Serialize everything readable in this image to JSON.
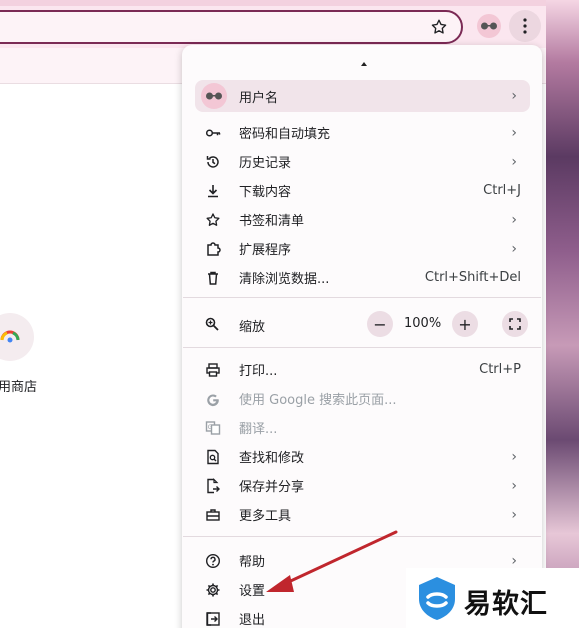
{
  "menu": {
    "profile": {
      "label": "用户名"
    },
    "items1": [
      {
        "label": "密码和自动填充",
        "shortcut": "",
        "submenu": true,
        "icon": "key-icon"
      },
      {
        "label": "历史记录",
        "shortcut": "",
        "submenu": true,
        "icon": "history-icon"
      },
      {
        "label": "下载内容",
        "shortcut": "Ctrl+J",
        "submenu": false,
        "icon": "download-icon"
      },
      {
        "label": "书签和清单",
        "shortcut": "",
        "submenu": true,
        "icon": "star-icon"
      },
      {
        "label": "扩展程序",
        "shortcut": "",
        "submenu": true,
        "icon": "puzzle-icon"
      },
      {
        "label": "清除浏览数据...",
        "shortcut": "Ctrl+Shift+Del",
        "submenu": false,
        "icon": "trash-icon"
      }
    ],
    "zoom": {
      "label": "缩放",
      "value": "100%",
      "minus": "−",
      "plus": "+"
    },
    "items2": [
      {
        "label": "打印...",
        "shortcut": "Ctrl+P",
        "submenu": false,
        "icon": "print-icon",
        "disabled": false
      },
      {
        "label": "使用 Google 搜索此页面...",
        "shortcut": "",
        "submenu": false,
        "icon": "google-icon",
        "disabled": true
      },
      {
        "label": "翻译...",
        "shortcut": "",
        "submenu": false,
        "icon": "translate-icon",
        "disabled": true
      },
      {
        "label": "查找和修改",
        "shortcut": "",
        "submenu": true,
        "icon": "find-icon",
        "disabled": false
      },
      {
        "label": "保存并分享",
        "shortcut": "",
        "submenu": true,
        "icon": "share-icon",
        "disabled": false
      },
      {
        "label": "更多工具",
        "shortcut": "",
        "submenu": true,
        "icon": "toolbox-icon",
        "disabled": false
      }
    ],
    "items3": [
      {
        "label": "帮助",
        "submenu": true,
        "icon": "help-icon"
      },
      {
        "label": "设置",
        "submenu": false,
        "icon": "gear-icon"
      },
      {
        "label": "退出",
        "submenu": false,
        "icon": "exit-icon"
      }
    ],
    "chevron": "›"
  },
  "page": {
    "store_label": "用商店"
  },
  "watermark": {
    "text": "易软汇"
  },
  "colors": {
    "accent": "#7b2a55",
    "arrow": "#c0262d",
    "menu_bg": "#fdfbfc"
  }
}
